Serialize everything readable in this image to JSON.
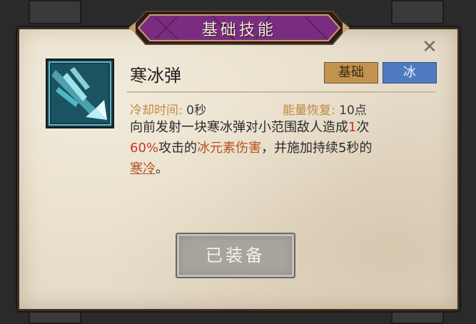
{
  "dialog": {
    "title": "基础技能",
    "close_icon": "close-icon"
  },
  "skill": {
    "name": "寒冰弹",
    "icon": "ice-shard-icon",
    "tags": [
      {
        "label": "基础",
        "color": "#c2924f"
      },
      {
        "label": "冰",
        "color": "#4f7bc0"
      }
    ],
    "cooldown_label": "冷却时间: ",
    "cooldown_value": "0秒",
    "energy_label": "能量恢复: ",
    "energy_value": "10点",
    "description": {
      "part1": "向前发射一块寒冰弹对小范围敌人造成",
      "hits": "1",
      "part2": "次",
      "percent": "60%",
      "part3": "攻击的",
      "element": "冰元素伤害",
      "part4": "，并施加持续5秒的",
      "effect": "寒冷",
      "part5": "。"
    }
  },
  "actions": {
    "equip_label": "已装备"
  }
}
